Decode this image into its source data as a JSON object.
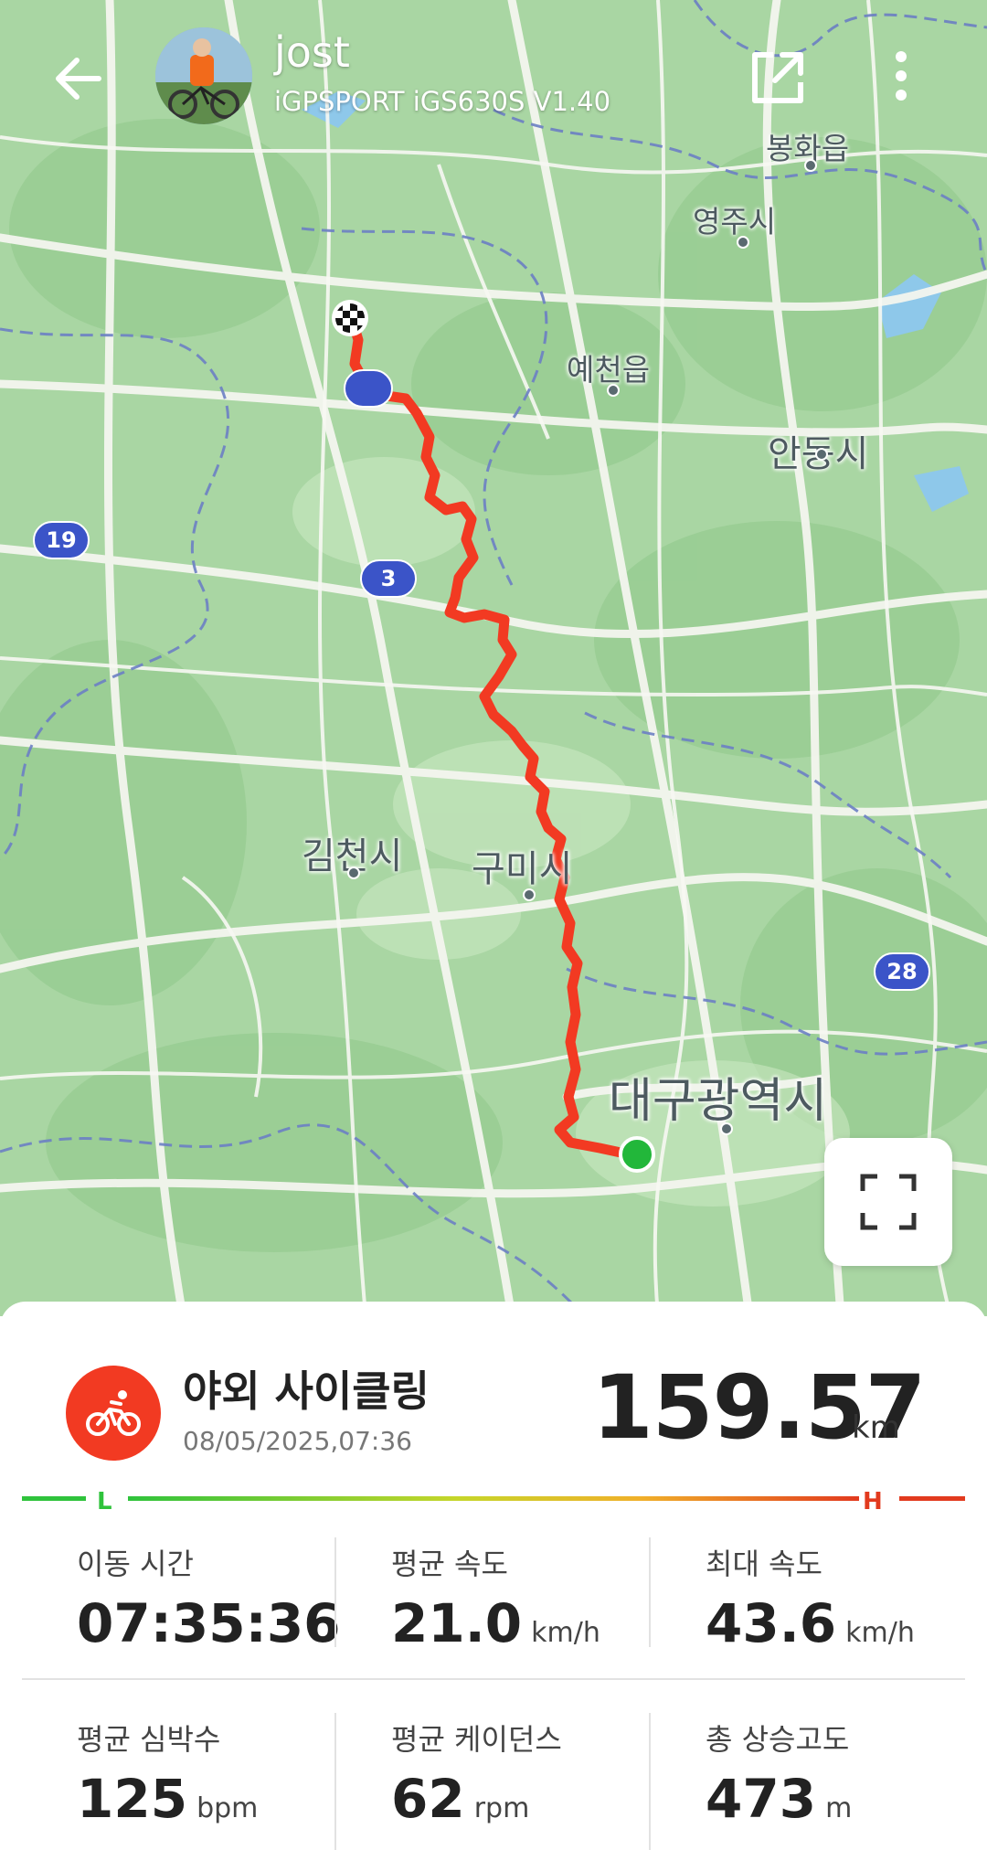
{
  "header": {
    "user_name": "jost",
    "device": "iGPSPORT iGS630S V1.40"
  },
  "map": {
    "places": {
      "bonghwa": "봉화읍",
      "yeongju": "영주시",
      "yecheon": "예천읍",
      "andong": "안동시",
      "gimcheon": "김천시",
      "gumi": "구미시",
      "daegu": "대구광역시"
    },
    "shields": {
      "route19": "19",
      "route3": "3",
      "route28": "28"
    },
    "route_color": "#f23a22",
    "start_marker_color": "#22b73a"
  },
  "activity": {
    "type": "야외 사이클링",
    "date": "08/05/2025,07:36",
    "distance": "159.57",
    "distance_unit": "km",
    "scale_low": "L",
    "scale_high": "H"
  },
  "stats": {
    "moving_time": {
      "label": "이동 시간",
      "value": "07:35:36",
      "unit": ""
    },
    "avg_speed": {
      "label": "평균 속도",
      "value": "21.0",
      "unit": "km/h"
    },
    "max_speed": {
      "label": "최대 속도",
      "value": "43.6",
      "unit": "km/h"
    },
    "avg_hr": {
      "label": "평균 심박수",
      "value": "125",
      "unit": "bpm"
    },
    "avg_cadence": {
      "label": "평균 케이던스",
      "value": "62",
      "unit": "rpm"
    },
    "total_ascent": {
      "label": "총 상승고도",
      "value": "473",
      "unit": "m"
    }
  }
}
